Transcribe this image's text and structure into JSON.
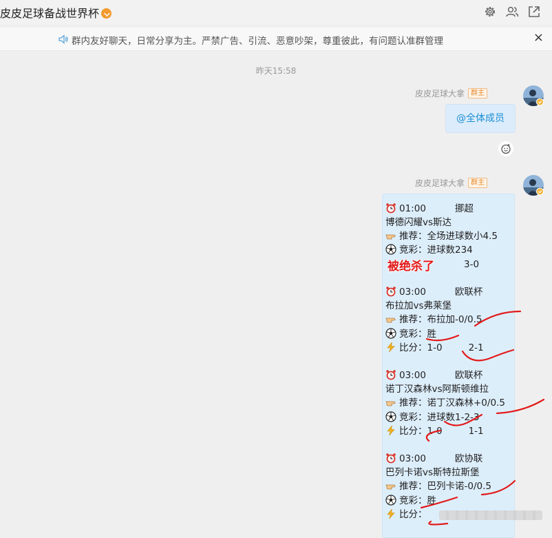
{
  "header": {
    "title": "皮皮足球备战世界杯"
  },
  "notice": {
    "text": "群内友好聊天，日常分享为主。严禁广告、引流、恶意吵架，尊重彼此，有问题认准群管理",
    "close": "×"
  },
  "chat": {
    "timestamp": "昨天15:58",
    "messages": [
      {
        "sender": "皮皮足球大拿",
        "badge": "群主",
        "text": "@全体成员"
      },
      {
        "sender": "皮皮足球大拿",
        "badge": "群主",
        "matches": [
          {
            "time": "01:00",
            "league": "挪超",
            "teams": "博德闪耀vs斯达",
            "recommend": "推荐：全场进球数小4.5",
            "lottery": "竞彩：进球数234",
            "overlay": "被绝杀了",
            "result": "3-0"
          },
          {
            "time": "03:00",
            "league": "欧联杯",
            "teams": "布拉加vs弗莱堡",
            "recommend": "推荐：布拉加-0/0.5",
            "lottery": "竞彩：胜",
            "score_label": "比分：1-0",
            "result": "2-1"
          },
          {
            "time": "03:00",
            "league": "欧联杯",
            "teams": "诺丁汉森林vs阿斯顿维拉",
            "recommend": "推荐：诺丁汉森林+0/0.5",
            "lottery": "竞彩：进球数1-2-3",
            "score_label": "比分：1-0",
            "result": "1-1"
          },
          {
            "time": "03:00",
            "league": "欧协联",
            "teams": "巴列卡诺vs斯特拉斯堡",
            "recommend": "推荐：巴列卡诺-0/0.5",
            "lottery": "竞彩：胜",
            "score_label": "比分："
          }
        ]
      }
    ]
  },
  "icons": {
    "settings": "gear-icon",
    "members": "members-icon",
    "share": "external-link-icon",
    "speaker": "speaker-icon",
    "alarm": "alarm-clock-icon",
    "pointing": "pointing-hand-icon",
    "soccer": "soccer-ball-icon",
    "lightning": "lightning-icon",
    "emoji": "emoji-reaction-icon"
  },
  "colors": {
    "accent_blue": "#1a8fd6",
    "bubble": "#ddeefb",
    "owner_badge": "#e48b2c",
    "red_marks": "#e21a1a"
  }
}
